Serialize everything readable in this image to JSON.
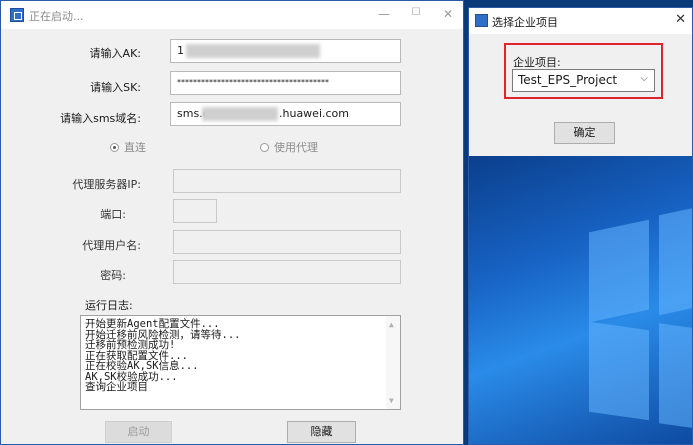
{
  "main_window": {
    "title": "正在启动...",
    "fields": {
      "ak_label": "请输入AK:",
      "ak_value": "1",
      "sk_label": "请输入SK:",
      "sk_value": "**************************************",
      "sms_label": "请输入sms域名:",
      "sms_prefix": "sms.c",
      "sms_suffix": ".huawei.com"
    },
    "connection": {
      "direct_label": "直连",
      "proxy_label": "使用代理"
    },
    "proxy": {
      "server_label": "代理服务器IP:",
      "port_label": "端口:",
      "user_label": "代理用户名:",
      "password_label": "密码:"
    },
    "log": {
      "label": "运行日志:",
      "lines": [
        "开始更新Agent配置文件...",
        "开始迁移前风险检测，请等待...",
        "迁移前预检测成功!",
        "正在获取配置文件...",
        "正在校验AK,SK信息...",
        "AK,SK校验成功...",
        "查询企业项目"
      ]
    },
    "buttons": {
      "start": "启动",
      "hide": "隐藏"
    }
  },
  "side_window": {
    "title": "选择企业项目",
    "close_glyph": "✕",
    "project_label": "企业项目:",
    "project_value": "Test_EPS_Project",
    "confirm": "确定"
  },
  "colors": {
    "highlight": "#e0242c",
    "window_border": "#2b5aa7"
  }
}
